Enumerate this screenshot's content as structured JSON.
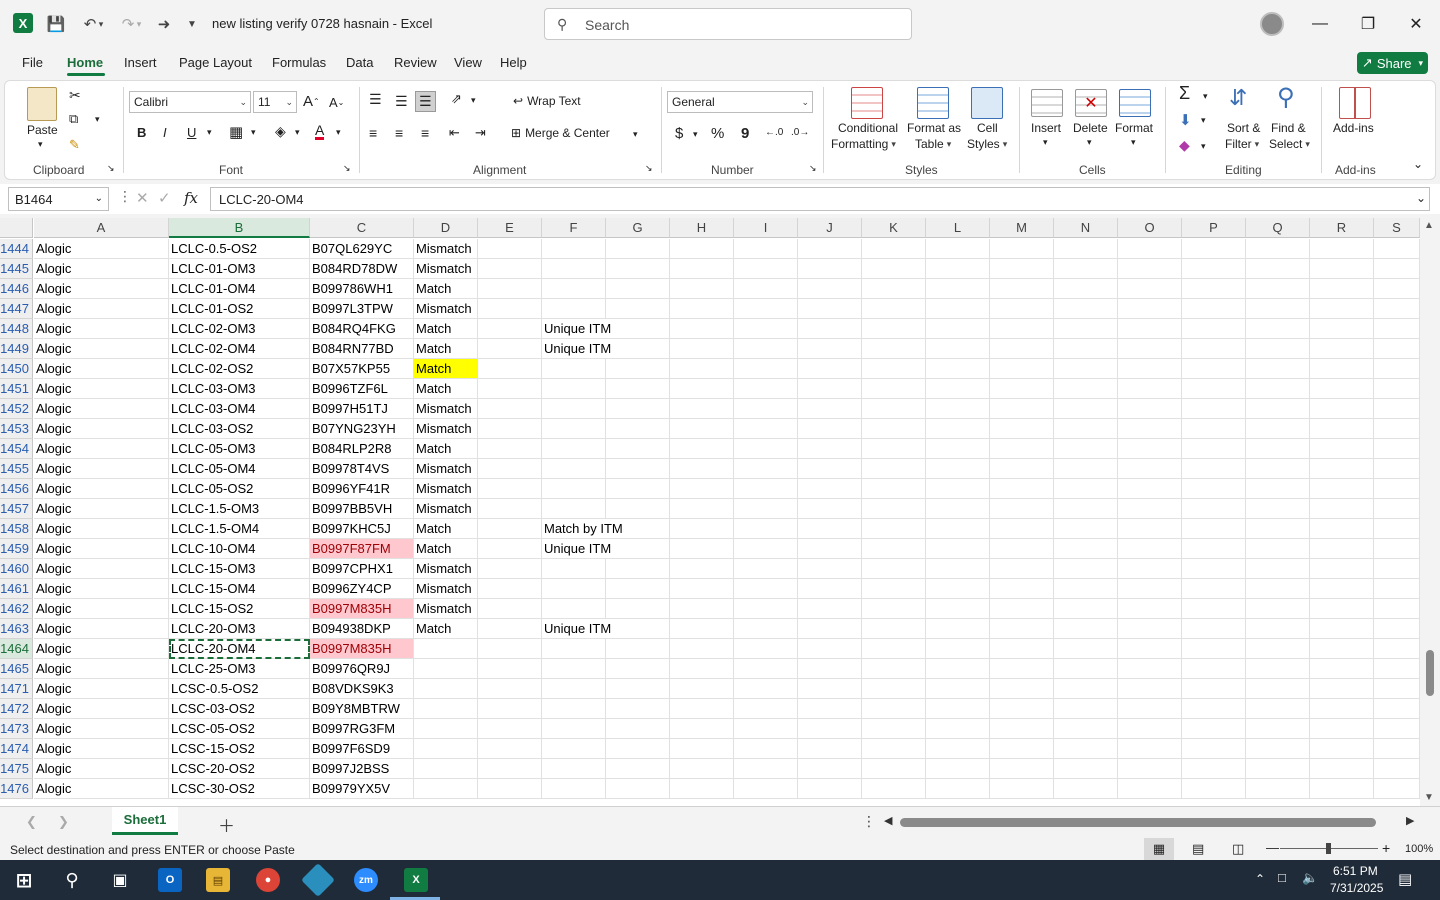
{
  "app": {
    "doc_title": "new listing verify 0728 hasnain  -  Excel",
    "search_placeholder": "Search",
    "share_label": "Share"
  },
  "menu": [
    "File",
    "Home",
    "Insert",
    "Page Layout",
    "Formulas",
    "Data",
    "Review",
    "View",
    "Help"
  ],
  "ribbon": {
    "clipboard": {
      "paste": "Paste",
      "label": "Clipboard"
    },
    "font": {
      "name": "Calibri",
      "size": "11",
      "label": "Font"
    },
    "alignment": {
      "wrap": "Wrap Text",
      "merge": "Merge & Center",
      "label": "Alignment"
    },
    "number": {
      "format": "General",
      "label": "Number",
      "currency": "$",
      "percent": "%",
      "comma": "9"
    },
    "styles": {
      "cond": "Conditional",
      "cond2": "Formatting",
      "table": "Format as",
      "table2": "Table",
      "cell": "Cell",
      "cell2": "Styles",
      "label": "Styles"
    },
    "cells": {
      "insert": "Insert",
      "delete": "Delete",
      "format": "Format",
      "label": "Cells"
    },
    "editing": {
      "sort": "Sort &",
      "sort2": "Filter",
      "find": "Find &",
      "find2": "Select",
      "label": "Editing"
    },
    "addins": {
      "btn": "Add-ins",
      "label": "Add-ins"
    }
  },
  "formula_bar": {
    "name_box": "B1464",
    "fx": "fx",
    "value": "LCLC-20-OM4"
  },
  "columns": [
    "A",
    "B",
    "C",
    "D",
    "E",
    "F",
    "G",
    "H",
    "I",
    "J",
    "K",
    "L",
    "M",
    "N",
    "O",
    "P",
    "Q",
    "R",
    "S"
  ],
  "selected_column": "B",
  "rows": [
    {
      "n": "1444",
      "a": "Alogic",
      "b": "LCLC-0.5-OS2",
      "c": "B07QL629YC",
      "d": "Mismatch",
      "f": ""
    },
    {
      "n": "1445",
      "a": "Alogic",
      "b": "LCLC-01-OM3",
      "c": "B084RD78DW",
      "d": "Mismatch",
      "f": ""
    },
    {
      "n": "1446",
      "a": "Alogic",
      "b": "LCLC-01-OM4",
      "c": "B099786WH1",
      "d": "Match",
      "f": ""
    },
    {
      "n": "1447",
      "a": "Alogic",
      "b": "LCLC-01-OS2",
      "c": "B0997L3TPW",
      "d": "Mismatch",
      "f": ""
    },
    {
      "n": "1448",
      "a": "Alogic",
      "b": "LCLC-02-OM3",
      "c": "B084RQ4FKG",
      "d": "Match",
      "f": "Unique ITM"
    },
    {
      "n": "1449",
      "a": "Alogic",
      "b": "LCLC-02-OM4",
      "c": "B084RN77BD",
      "d": "Match",
      "f": "Unique ITM"
    },
    {
      "n": "1450",
      "a": "Alogic",
      "b": "LCLC-02-OS2",
      "c": "B07X57KP55",
      "d": "Match",
      "f": "",
      "dfill": "yellow"
    },
    {
      "n": "1451",
      "a": "Alogic",
      "b": "LCLC-03-OM3",
      "c": "B0996TZF6L",
      "d": "Match",
      "f": ""
    },
    {
      "n": "1452",
      "a": "Alogic",
      "b": "LCLC-03-OM4",
      "c": "B0997H51TJ",
      "d": "Mismatch",
      "f": ""
    },
    {
      "n": "1453",
      "a": "Alogic",
      "b": "LCLC-03-OS2",
      "c": "B07YNG23YH",
      "d": "Mismatch",
      "f": ""
    },
    {
      "n": "1454",
      "a": "Alogic",
      "b": "LCLC-05-OM3",
      "c": "B084RLP2R8",
      "d": "Match",
      "f": ""
    },
    {
      "n": "1455",
      "a": "Alogic",
      "b": "LCLC-05-OM4",
      "c": "B09978T4VS",
      "d": "Mismatch",
      "f": ""
    },
    {
      "n": "1456",
      "a": "Alogic",
      "b": "LCLC-05-OS2",
      "c": "B0996YF41R",
      "d": "Mismatch",
      "f": ""
    },
    {
      "n": "1457",
      "a": "Alogic",
      "b": "LCLC-1.5-OM3",
      "c": "B0997BB5VH",
      "d": "Mismatch",
      "f": ""
    },
    {
      "n": "1458",
      "a": "Alogic",
      "b": "LCLC-1.5-OM4",
      "c": "B0997KHC5J",
      "d": "Match",
      "f": "Match by ITM"
    },
    {
      "n": "1459",
      "a": "Alogic",
      "b": "LCLC-10-OM4",
      "c": "B0997F87FM",
      "d": "Match",
      "f": "Unique ITM",
      "cfill": "red"
    },
    {
      "n": "1460",
      "a": "Alogic",
      "b": "LCLC-15-OM3",
      "c": "B0997CPHX1",
      "d": "Mismatch",
      "f": ""
    },
    {
      "n": "1461",
      "a": "Alogic",
      "b": "LCLC-15-OM4",
      "c": "B0996ZY4CP",
      "d": "Mismatch",
      "f": ""
    },
    {
      "n": "1462",
      "a": "Alogic",
      "b": "LCLC-15-OS2",
      "c": "B0997M835H",
      "d": "Mismatch",
      "f": "",
      "cfill": "red"
    },
    {
      "n": "1463",
      "a": "Alogic",
      "b": "LCLC-20-OM3",
      "c": "B094938DKP",
      "d": "Match",
      "f": "Unique ITM"
    },
    {
      "n": "1464",
      "a": "Alogic",
      "b": "LCLC-20-OM4",
      "c": "B0997M835H",
      "d": "",
      "f": "",
      "cfill": "red",
      "active": true
    },
    {
      "n": "1465",
      "a": "Alogic",
      "b": "LCLC-25-OM3",
      "c": "B09976QR9J",
      "d": "",
      "f": ""
    },
    {
      "n": "1471",
      "a": "Alogic",
      "b": "LCSC-0.5-OS2",
      "c": "B08VDKS9K3",
      "d": "",
      "f": ""
    },
    {
      "n": "1472",
      "a": "Alogic",
      "b": "LCSC-03-OS2",
      "c": "B09Y8MBTRW",
      "d": "",
      "f": ""
    },
    {
      "n": "1473",
      "a": "Alogic",
      "b": "LCSC-05-OS2",
      "c": "B0997RG3FM",
      "d": "",
      "f": ""
    },
    {
      "n": "1474",
      "a": "Alogic",
      "b": "LCSC-15-OS2",
      "c": "B0997F6SD9",
      "d": "",
      "f": ""
    },
    {
      "n": "1475",
      "a": "Alogic",
      "b": "LCSC-20-OS2",
      "c": "B0997J2BSS",
      "d": "",
      "f": ""
    },
    {
      "n": "1476",
      "a": "Alogic",
      "b": "LCSC-30-OS2",
      "c": "B09979YX5V",
      "d": "",
      "f": ""
    }
  ],
  "sheet_tab": "Sheet1",
  "status": {
    "message": "Select destination and press ENTER or choose Paste",
    "zoom": "100%"
  },
  "taskbar": {
    "time": "6:51 PM",
    "date": "7/31/2025"
  },
  "colors": {
    "accent": "#107c41",
    "red_fill": "#ffc7ce",
    "yellow_fill": "#ffff00"
  }
}
